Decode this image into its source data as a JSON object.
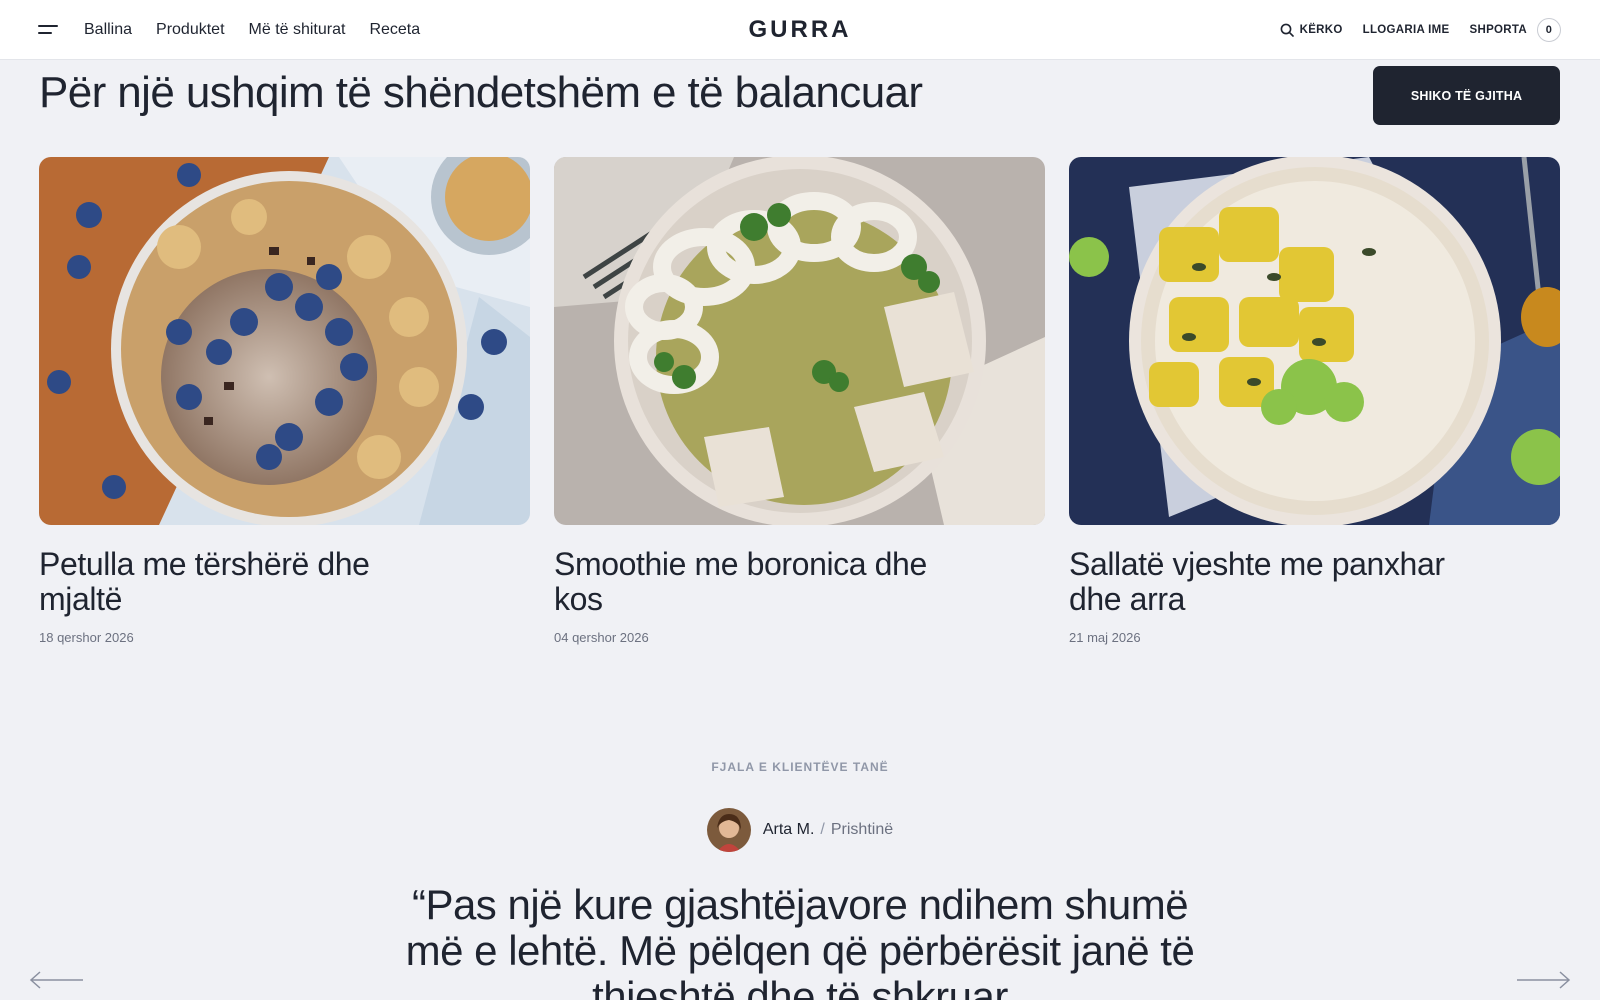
{
  "header": {
    "nav": [
      "Ballina",
      "Produktet",
      "Më të shiturat",
      "Receta"
    ],
    "logo": "GURRA",
    "search_label": "KËRKO",
    "account_label": "LLOGARIA IME",
    "cart_label": "SHPORTA",
    "cart_count": "0"
  },
  "section": {
    "title": "Për një ushqim të shëndetshëm e të balancuar",
    "view_all_label": "SHIKO TË GJITHA"
  },
  "recipes": [
    {
      "title": "Petulla me tërshërë dhe mjaltë",
      "date": "18 qershor 2026"
    },
    {
      "title": "Smoothie me boronica dhe kos",
      "date": "04 qershor 2026"
    },
    {
      "title": "Sallatë vjeshte me panxhar dhe arra",
      "date": "21 maj 2026"
    }
  ],
  "testimonials": {
    "eyebrow": "FJALA E KLIENTËVE TANË",
    "author_name": "Arta M.",
    "author_separator": "/",
    "author_city": "Prishtinë",
    "quote": "“Pas një kure gjashtëjavore ndihem shumë më e lehtë. Më pëlqen që përbërësit janë të thjeshtë dhe të shkruar"
  },
  "colors": {
    "background": "#f0f1f5",
    "text": "#1f2430",
    "button": "#1f2430",
    "muted": "#9097a8"
  }
}
